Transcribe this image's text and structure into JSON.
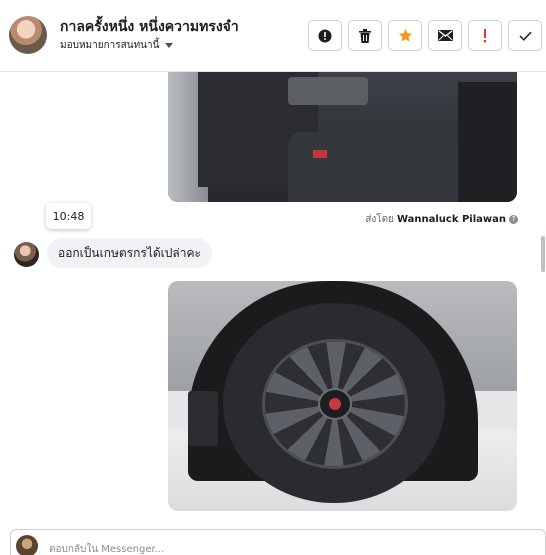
{
  "header": {
    "title": "กาลครั้งหนึ่ง หนึ่งความทรงจำ",
    "subtitle": "มอบหมายการสนทนานี้"
  },
  "actions": [
    {
      "icon": "alert-circle-icon"
    },
    {
      "icon": "trash-icon"
    },
    {
      "icon": "star-icon",
      "color": "#f7981c"
    },
    {
      "icon": "mail-icon"
    },
    {
      "icon": "exclamation-icon",
      "color": "#e4332e"
    },
    {
      "icon": "check-icon"
    }
  ],
  "thread": {
    "sent_by_prefix": "ส่งโดย",
    "sent_by_name": "Wannaluck Pilawan",
    "timestamp": "10:48",
    "incoming_message": "ออกเป็นเกษตรกรได้เปล่าคะ"
  },
  "composer": {
    "placeholder": "ตอบกลับใน Messenger..."
  },
  "colors": {
    "bubble_bg": "#f0f2f5",
    "star": "#f7981c",
    "exclamation": "#e4332e"
  }
}
